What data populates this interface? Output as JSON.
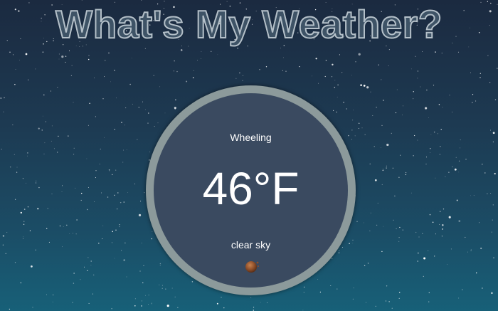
{
  "header": {
    "title": "What's My Weather?"
  },
  "weather": {
    "city": "Wheeling",
    "temperature": "46°F",
    "condition": "clear sky",
    "icon": "clear-sky-night-icon"
  },
  "colors": {
    "ring": "#8c9a9b",
    "disc": "#3a4a60",
    "title_fill": "#3e5366",
    "title_stroke": "#b4c0c9"
  }
}
